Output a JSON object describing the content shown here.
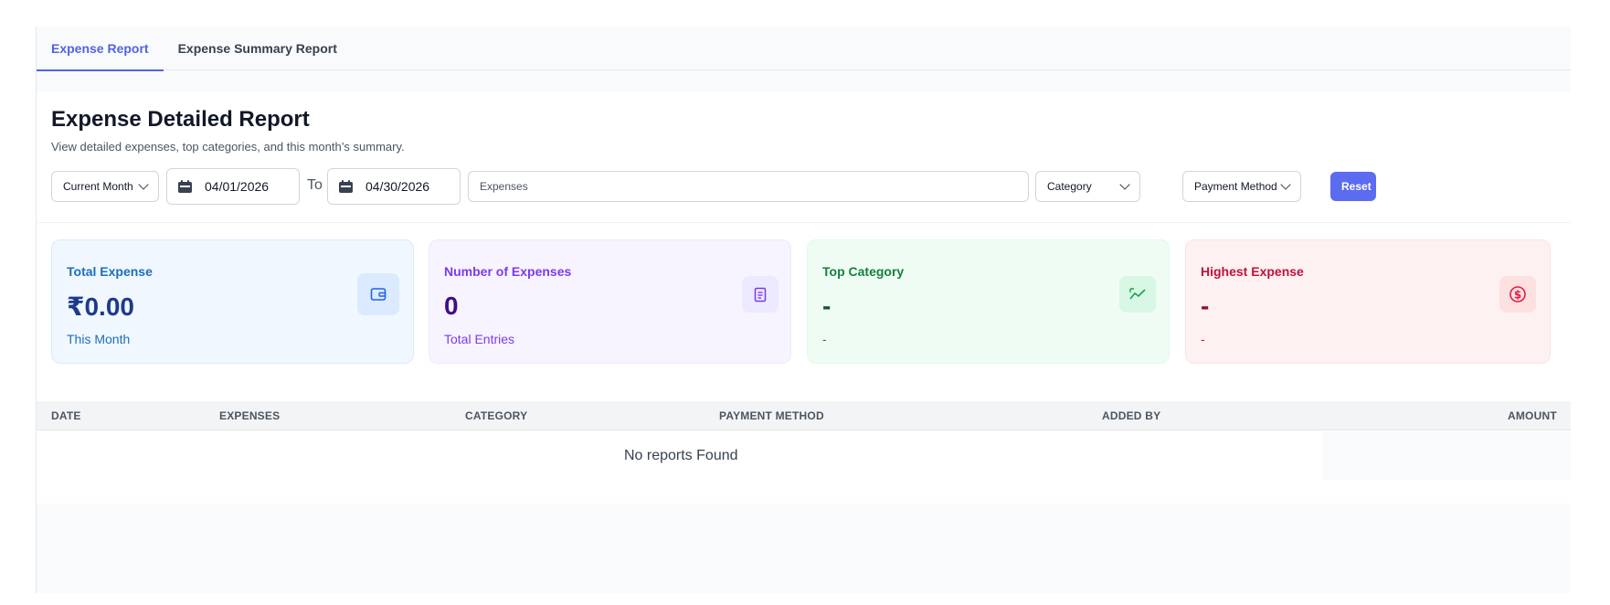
{
  "tabs": [
    {
      "label": "Expense Report",
      "active": true
    },
    {
      "label": "Expense Summary Report",
      "active": false
    }
  ],
  "header": {
    "title": "Expense Detailed Report",
    "subtitle": "View detailed expenses, top categories, and this month’s summary."
  },
  "filters": {
    "period": "Current Month",
    "from_date": "04/01/2026",
    "to_label": "To",
    "to_date": "04/30/2026",
    "search_placeholder": "Expenses",
    "category": "Category",
    "payment_method": "Payment Method",
    "reset_label": "Reset"
  },
  "cards": [
    {
      "label": "Total Expense",
      "value": "₹0.00",
      "sub": "This Month",
      "icon": "wallet-icon",
      "color": "#1d6fb8"
    },
    {
      "label": "Number of Expenses",
      "value": "0",
      "sub": "Total Entries",
      "icon": "receipt-icon",
      "color": "#7c3aed"
    },
    {
      "label": "Top Category",
      "value": "-",
      "sub": "-",
      "icon": "trend-icon",
      "color": "#15803d"
    },
    {
      "label": "Highest Expense",
      "value": "-",
      "sub": "-",
      "icon": "dollar-icon",
      "color": "#be123c"
    }
  ],
  "table": {
    "columns": [
      "DATE",
      "EXPENSES",
      "CATEGORY",
      "PAYMENT METHOD",
      "ADDED BY",
      "AMOUNT"
    ],
    "empty_message": "No reports Found"
  },
  "accent": "#5b6cf0"
}
